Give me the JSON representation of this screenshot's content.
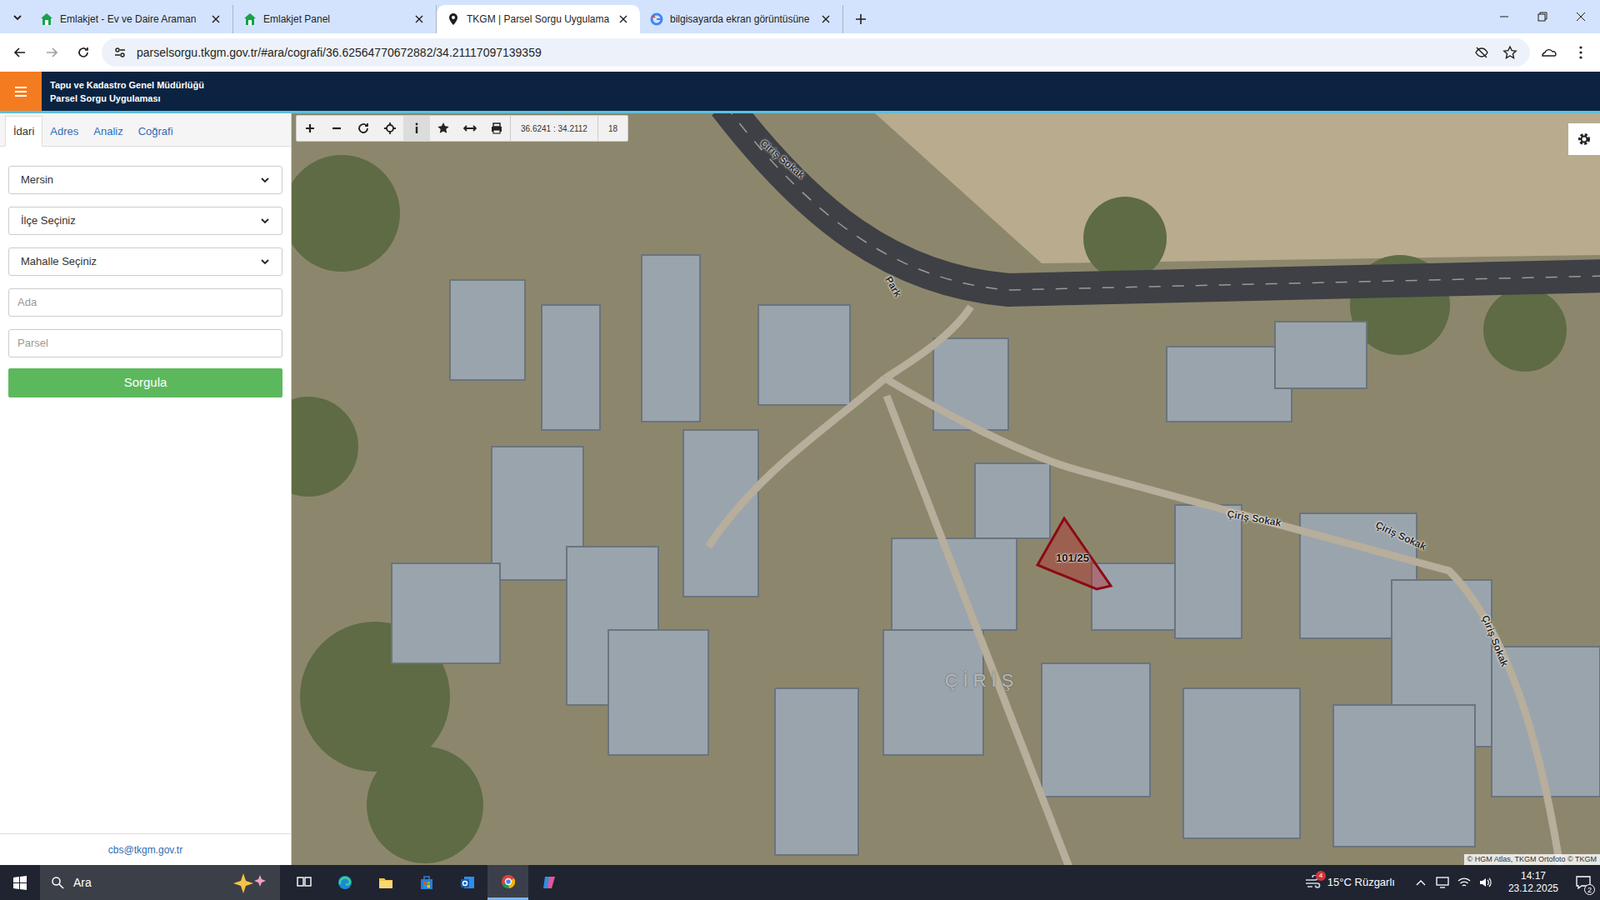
{
  "browser": {
    "tabs": [
      {
        "label": "Emlakjet - Ev ve Daire Araman",
        "selected": false,
        "kind": "emlakjet"
      },
      {
        "label": "Emlakjet Panel",
        "selected": false,
        "kind": "emlakjet"
      },
      {
        "label": "TKGM | Parsel Sorgu Uygulama",
        "selected": true,
        "kind": "pin"
      },
      {
        "label": "bilgisayarda ekran görüntüsüne",
        "selected": false,
        "kind": "google"
      }
    ],
    "address": "parselsorgu.tkgm.gov.tr/#ara/cografi/36.62564770672882/34.21117097139359"
  },
  "app": {
    "title": "Tapu ve Kadastro Genel Müdürlüğü",
    "subtitle": "Parsel Sorgu Uygulaması"
  },
  "sidebar": {
    "tabs": [
      {
        "label": "İdari",
        "selected": true
      },
      {
        "label": "Adres",
        "selected": false
      },
      {
        "label": "Analiz",
        "selected": false
      },
      {
        "label": "Coğrafi",
        "selected": false
      }
    ],
    "fields": [
      {
        "kind": "select",
        "value": "Mersin"
      },
      {
        "kind": "select",
        "value": "İlçe Seçiniz"
      },
      {
        "kind": "select",
        "value": "Mahalle Seçiniz"
      },
      {
        "kind": "input",
        "placeholder": "Ada"
      },
      {
        "kind": "input",
        "placeholder": "Parsel"
      }
    ],
    "submit": "Sorgula",
    "footer": "cbs@tkgm.gov.tr"
  },
  "map": {
    "coordinates": "36.6241 : 34.2112",
    "zoom": "18",
    "labels": [
      {
        "text": "Çiriş Sokak",
        "kind": "street"
      },
      {
        "text": "Çiriş Sokak",
        "kind": "street"
      },
      {
        "text": "Çiriş Sokak",
        "kind": "street"
      },
      {
        "text": "Çiriş Sokak",
        "kind": "street"
      },
      {
        "text": "ÇİRİŞ",
        "kind": "place"
      },
      {
        "text": "Park",
        "kind": "poi"
      }
    ],
    "parcel": "101/25",
    "attribution": "© HGM Atlas, TKGM Ortofoto © TKGM"
  },
  "taskbar": {
    "search": "Ara",
    "weather_badge": "4",
    "weather": "15°C Rüzgarlı",
    "time": "14:17",
    "date": "23.12.2025",
    "notifications": "2"
  }
}
